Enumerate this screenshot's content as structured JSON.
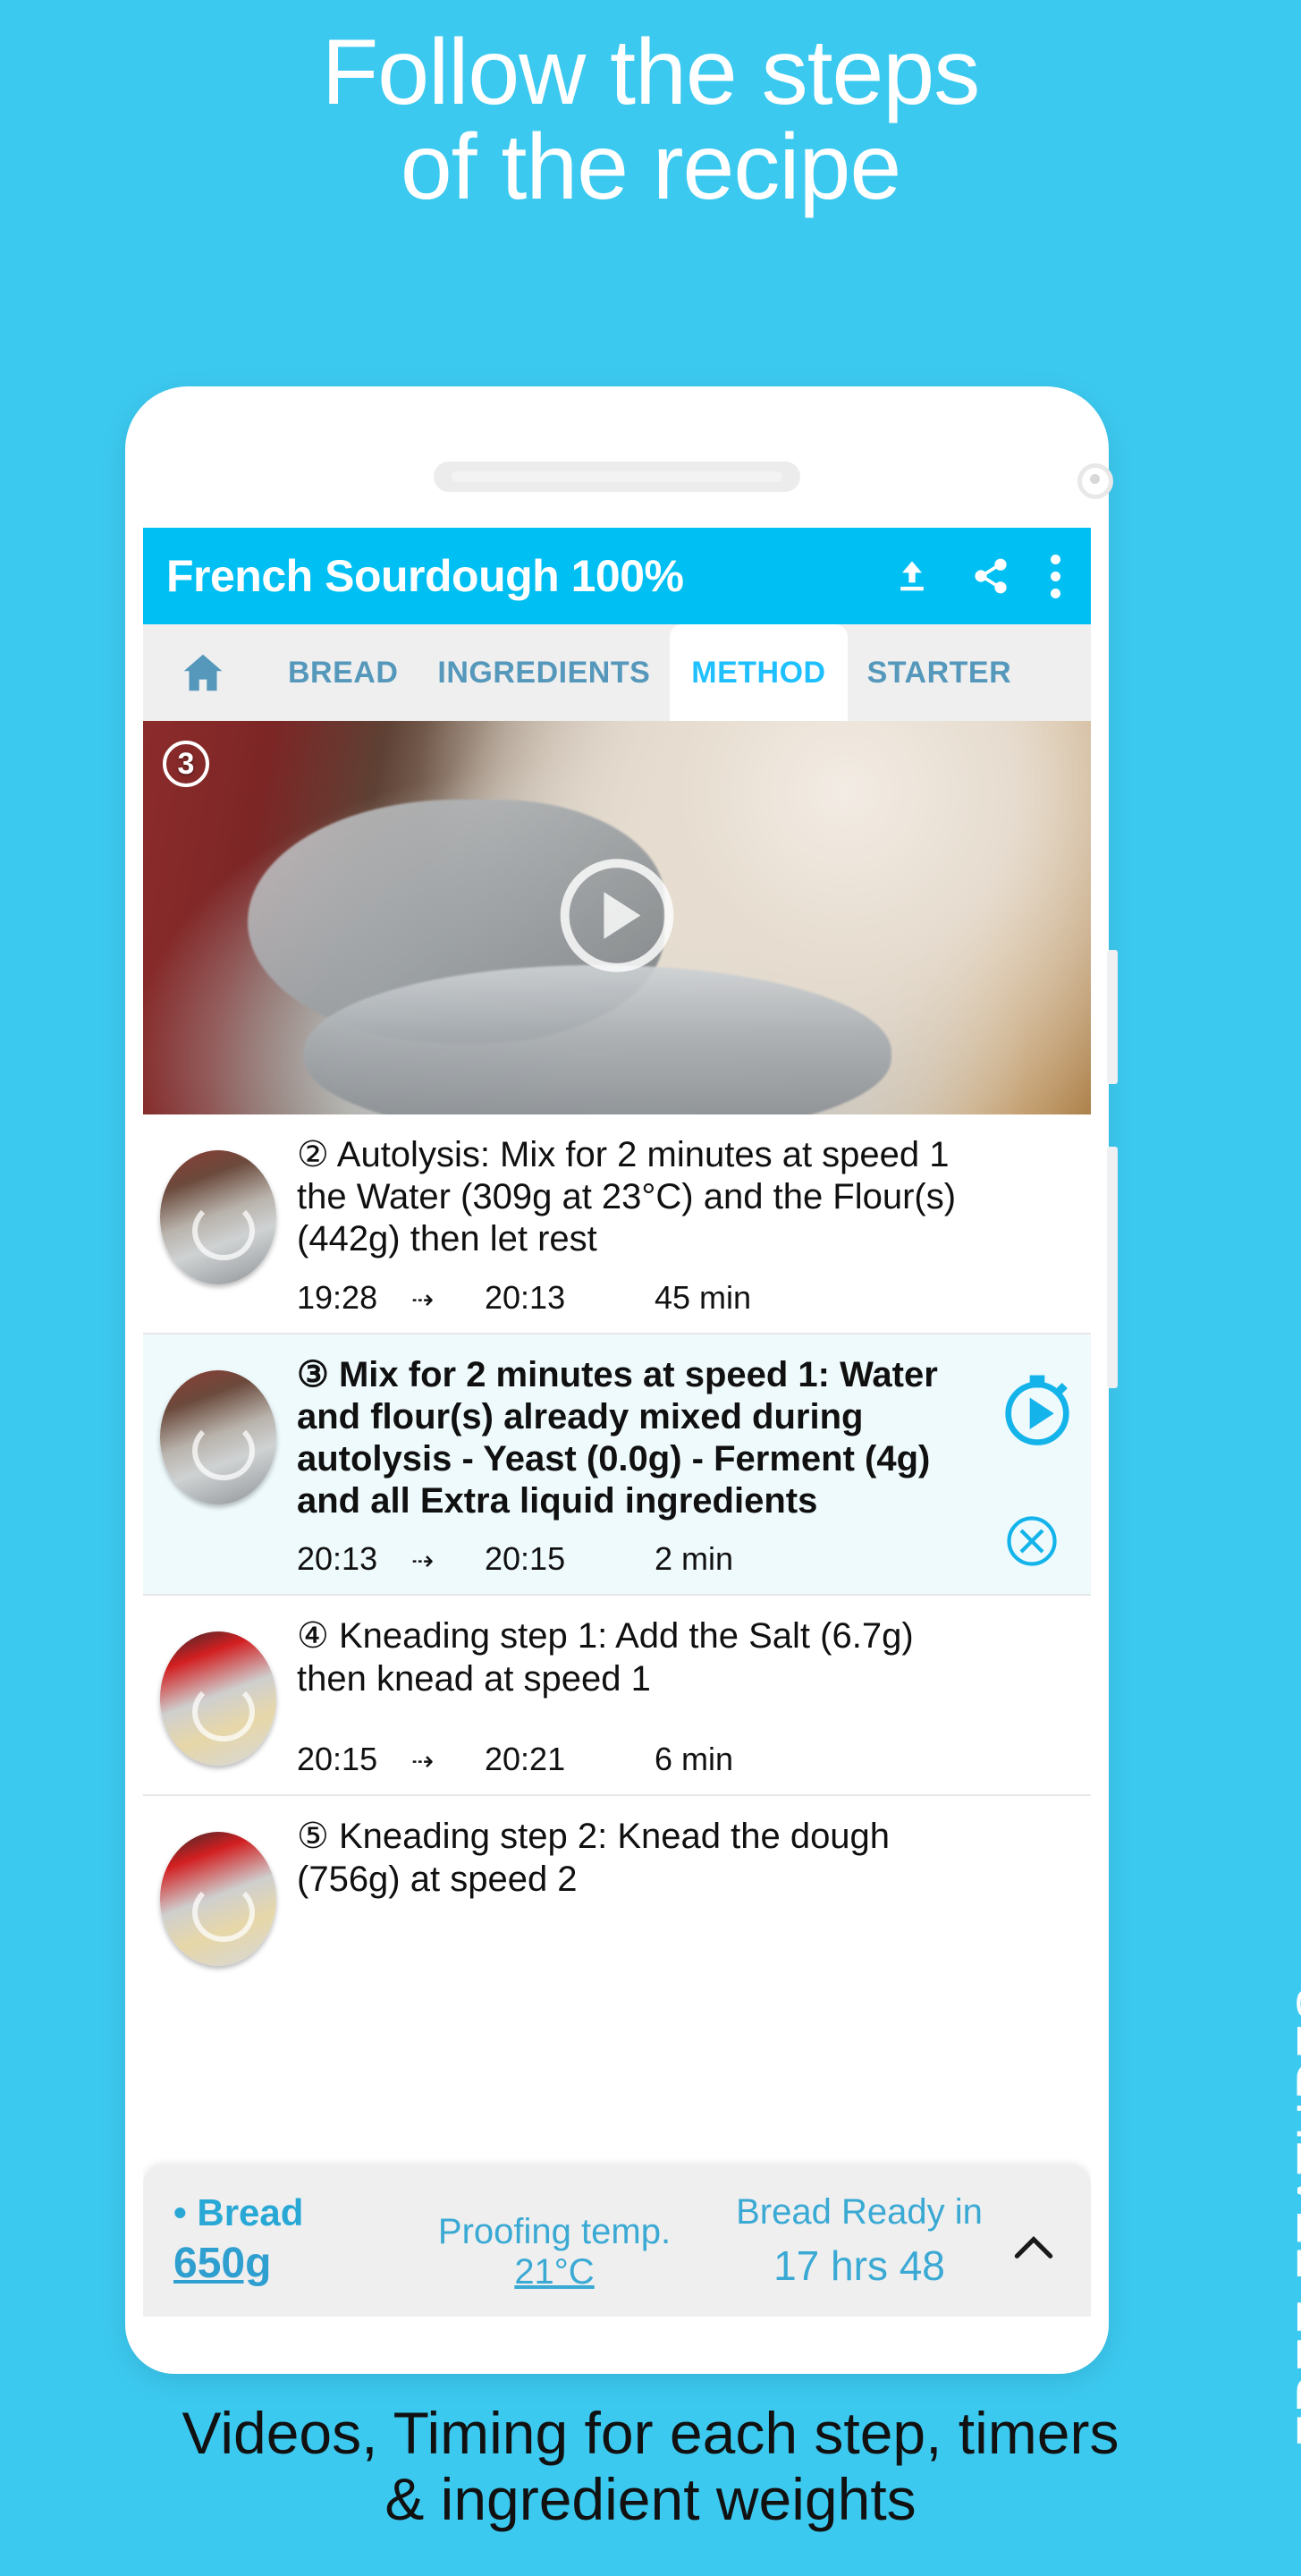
{
  "promo": {
    "headline_line1": "Follow the steps",
    "headline_line2": "of the recipe",
    "caption_line1": "Videos, Timing for each step, timers",
    "caption_line2": "& ingredient weights",
    "side_label": "FREE FEATURES",
    "background_color": "#3cc9f0",
    "accent_color": "#00bff2"
  },
  "app": {
    "title": "French Sourdough 100%",
    "actions": [
      "upload-icon",
      "share-icon",
      "overflow-menu-icon"
    ],
    "tabs": [
      {
        "label": "",
        "icon": "home-icon",
        "active": false
      },
      {
        "label": "BREAD",
        "active": false
      },
      {
        "label": "INGREDIENTS",
        "active": false
      },
      {
        "label": "METHOD",
        "active": true
      },
      {
        "label": "STARTER",
        "active": false
      }
    ]
  },
  "video": {
    "step_badge": "3",
    "play_icon": "play-circle-icon"
  },
  "steps": [
    {
      "text": "② Autolysis: Mix for 2 minutes at speed 1 the Water (309g at 23°C) and the Flour(s) (442g) then let rest",
      "start": "19:28",
      "arrow": "→",
      "end": "20:13",
      "duration": "45 min",
      "active": false,
      "thumb": "mixing-bowl-thumbnail"
    },
    {
      "text": "③ Mix for 2 minutes at speed 1: Water and flour(s) already mixed during autolysis - Yeast (0.0g) - Ferment (4g) and all Extra liquid ingredients",
      "start": "20:13",
      "arrow": "→",
      "end": "20:15",
      "duration": "2 min",
      "active": true,
      "thumb": "mixing-bowl-thumbnail",
      "timer_icon": "stopwatch-play-icon",
      "cancel_icon": "cancel-circle-icon"
    },
    {
      "text": "④ Kneading step 1: Add the Salt (6.7g) then knead at speed 1",
      "start": "20:15",
      "arrow": "→",
      "end": "20:21",
      "duration": "6 min",
      "active": false,
      "thumb": "stand-mixer-thumbnail"
    },
    {
      "text": "⑤ Kneading step 2: Knead the dough (756g) at speed 2",
      "start": "",
      "arrow": "",
      "end": "",
      "duration": "",
      "active": false,
      "thumb": "stand-mixer-thumbnail"
    }
  ],
  "bottom_bar": {
    "bullet_label": "• Bread",
    "weight": "650g",
    "proofing_label": "Proofing temp. ",
    "proofing_value": "21°C",
    "ready_label": "Bread Ready in",
    "ready_value": "17 hrs 48",
    "chevron": "chevron-up-icon"
  }
}
